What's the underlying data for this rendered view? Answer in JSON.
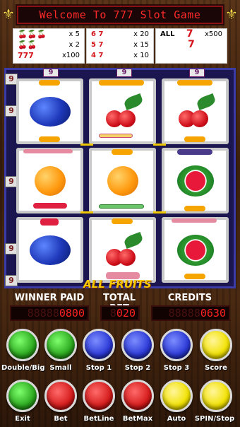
{
  "header": {
    "title": "Welcome To 777 Slot Game"
  },
  "paytable": {
    "col1": [
      {
        "symbols": "🍒🍒🍒",
        "mult": "x 5"
      },
      {
        "symbols": "🍒🍒",
        "mult": "x 2"
      },
      {
        "symbols": "777",
        "mult": "x100"
      }
    ],
    "col2": [
      {
        "symbols": "6 7",
        "mult": "x 20"
      },
      {
        "symbols": "5 7",
        "mult": "x 15"
      },
      {
        "symbols": "4 7",
        "mult": "x 10"
      }
    ],
    "col3": [
      {
        "symbols": "ALL",
        "mult": "x500"
      }
    ]
  },
  "reels": {
    "line_count": "9",
    "grid": [
      [
        "plum",
        "cherries",
        "cherries"
      ],
      [
        "orange",
        "orange",
        "melon"
      ],
      [
        "plum",
        "cherries",
        "melon"
      ]
    ]
  },
  "brand": "ALL FRUITS",
  "counters": {
    "winner_paid": {
      "label": "WINNER PAID",
      "dim": "88888",
      "value": "0800"
    },
    "total_bet": {
      "label": "TOTAL BET",
      "dim": "8",
      "value": "020"
    },
    "credits": {
      "label": "CREDITS",
      "dim": "88888",
      "value": "0630"
    }
  },
  "buttons_row1": [
    {
      "label": "Double/Big",
      "color": "#2aa61d"
    },
    {
      "label": "Small",
      "color": "#2aa61d"
    },
    {
      "label": "Stop 1",
      "color": "#2b38d6"
    },
    {
      "label": "Stop 2",
      "color": "#2b38d6"
    },
    {
      "label": "Stop 3",
      "color": "#2b38d6"
    },
    {
      "label": "Score",
      "color": "#f2e200"
    }
  ],
  "buttons_row2": [
    {
      "label": "Exit",
      "color": "#2aa61d"
    },
    {
      "label": "Bet",
      "color": "#d41a1a"
    },
    {
      "label": "BetLine",
      "color": "#d41a1a"
    },
    {
      "label": "BetMax",
      "color": "#d41a1a"
    },
    {
      "label": "Auto",
      "color": "#f2e200"
    },
    {
      "label": "SPIN/Stop",
      "color": "#f2e200"
    }
  ]
}
